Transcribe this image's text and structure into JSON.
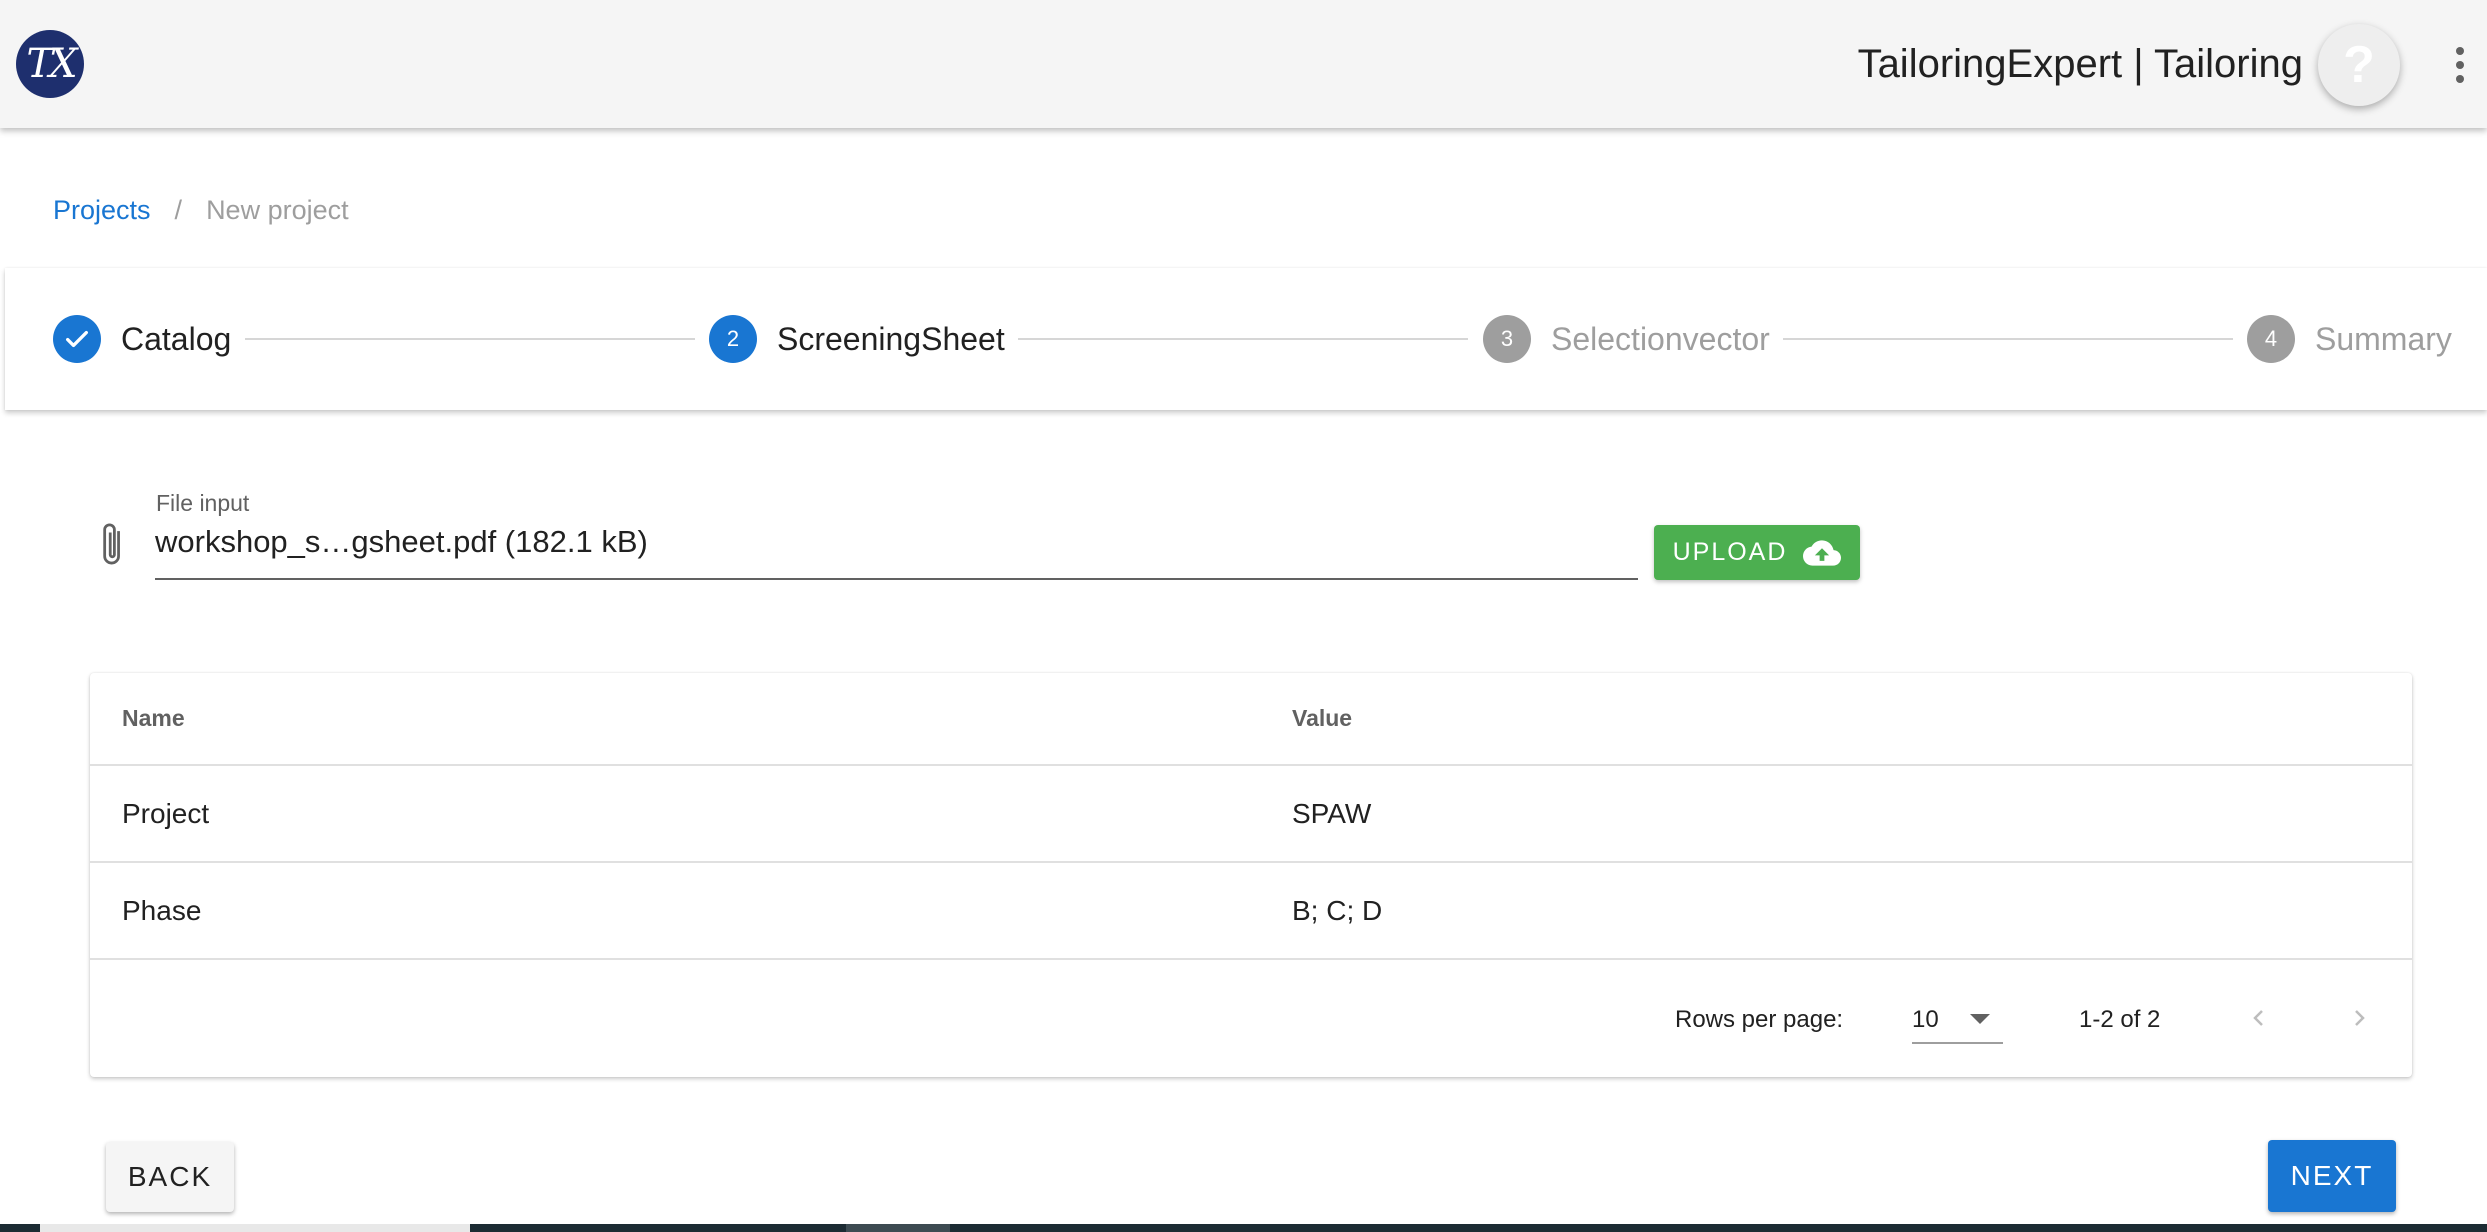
{
  "app": {
    "logo_text": "TX",
    "title": "TailoringExpert | Tailoring",
    "help_label": "?"
  },
  "breadcrumb": {
    "root": "Projects",
    "separator": "/",
    "current": "New project"
  },
  "stepper": {
    "steps": [
      {
        "number": "1",
        "label": "Catalog",
        "state": "done"
      },
      {
        "number": "2",
        "label": "ScreeningSheet",
        "state": "active"
      },
      {
        "number": "3",
        "label": "Selectionvector",
        "state": "todo"
      },
      {
        "number": "4",
        "label": "Summary",
        "state": "todo"
      }
    ]
  },
  "file_input": {
    "label": "File input",
    "value": "workshop_s…gsheet.pdf (182.1 kB)"
  },
  "upload_button": {
    "label": "UPLOAD"
  },
  "table": {
    "columns": [
      "Name",
      "Value"
    ],
    "rows": [
      [
        "Project",
        "SPAW"
      ],
      [
        "Phase",
        "B; C; D"
      ]
    ],
    "footer": {
      "rows_per_page_label": "Rows per page:",
      "rows_per_page_value": "10",
      "page_info": "1-2 of 2"
    }
  },
  "nav": {
    "back_label": "BACK",
    "next_label": "NEXT"
  },
  "colors": {
    "primary": "#1976d2",
    "success": "#4caf50",
    "inactive": "#9e9e9e",
    "logo_bg": "#1e2f6e"
  }
}
